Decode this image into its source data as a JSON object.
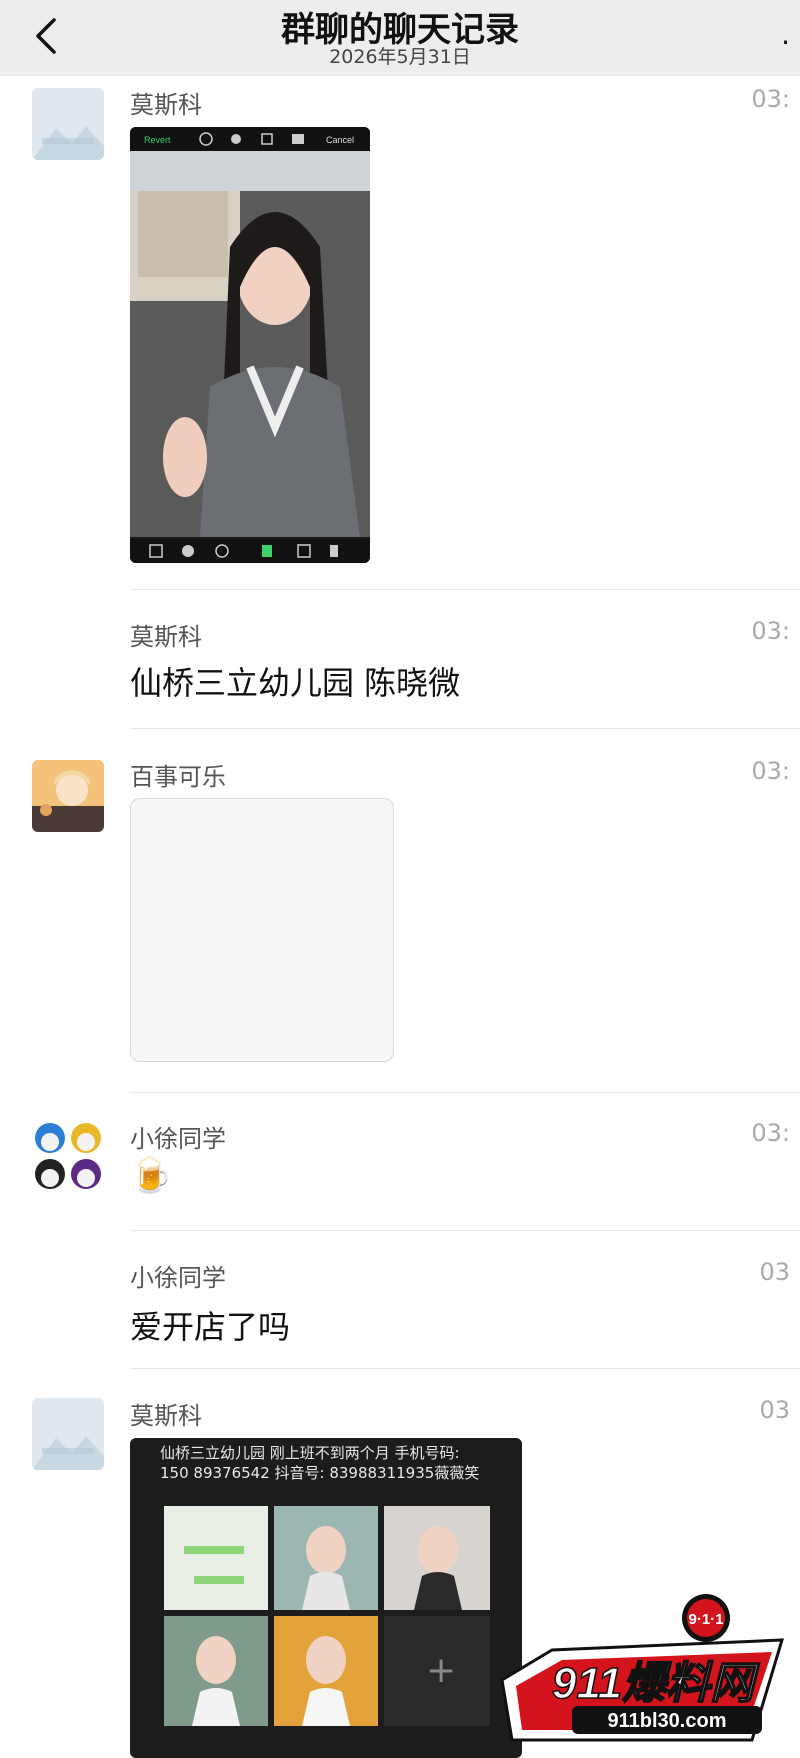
{
  "header": {
    "title": "群聊的聊天记录",
    "date": "2026年5月31日",
    "more": "·"
  },
  "messages": [
    {
      "sender": "莫斯科",
      "time": "03:",
      "type": "image",
      "photo_toolbar": {
        "left": "Revert",
        "right": "Cancel"
      }
    },
    {
      "sender": "莫斯科",
      "time": "03:",
      "type": "text",
      "text": "仙桥三立幼儿园 陈晓微"
    },
    {
      "sender": "百事可乐",
      "time": "03:",
      "type": "image_placeholder"
    },
    {
      "sender": "小徐同学",
      "time": "03:",
      "type": "emoji",
      "text": "🍺"
    },
    {
      "sender": "小徐同学",
      "time": "03",
      "type": "text",
      "text": "爱开店了吗"
    },
    {
      "sender": "莫斯科",
      "time": "03",
      "type": "image",
      "caption_line1": "仙桥三立幼儿园 刚上班不到两个月 手机号码:",
      "caption_line2": "150 89376542 抖音号: 83988311935薇薇笑",
      "add_symbol": "+"
    }
  ],
  "watermark": {
    "badge": "9·1·1",
    "brand": "911爆料网",
    "url": "911bl30.com"
  },
  "colors": {
    "header_bg": "#ededed",
    "divider": "#e6e6e6",
    "watermark_red": "#d4141c"
  }
}
